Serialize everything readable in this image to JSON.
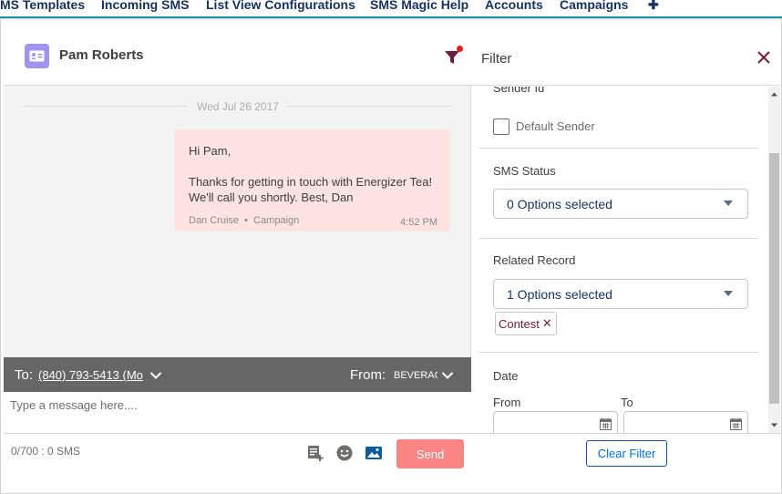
{
  "nav": {
    "tabs": [
      "MS Templates",
      "Incoming SMS",
      "List View Configurations",
      "SMS Magic Help",
      "Accounts",
      "Campaigns"
    ],
    "add_icon": "plus-icon"
  },
  "conversation": {
    "contact_name": "Pam Roberts",
    "date_separator": "Wed Jul 26 2017",
    "message": {
      "greeting": "Hi Pam,",
      "body": "Thanks for getting in touch with Energizer Tea! We'll call you shortly. Best, Dan",
      "sender": "Dan Cruise",
      "source": "Campaign",
      "time": "4:52 PM"
    },
    "to_label": "To:",
    "to_number": "(840) 793-5413 (Mo",
    "from_label": "From:",
    "from_value": "BEVERAGE",
    "input_placeholder": "Type a message here....",
    "counter": "0/700 : 0 SMS",
    "send_label": "Send",
    "send_color": "#f98585"
  },
  "filter": {
    "title": "Filter",
    "sender_id_label": "Sender Id",
    "default_sender_label": "Default Sender",
    "sms_status_label": "SMS Status",
    "sms_status_value": "0 Options selected",
    "related_record_label": "Related Record",
    "related_record_value": "1 Options selected",
    "related_record_pill": "Contest",
    "date_label": "Date",
    "from_label": "From",
    "to_label": "To",
    "clear_label": "Clear Filter"
  }
}
